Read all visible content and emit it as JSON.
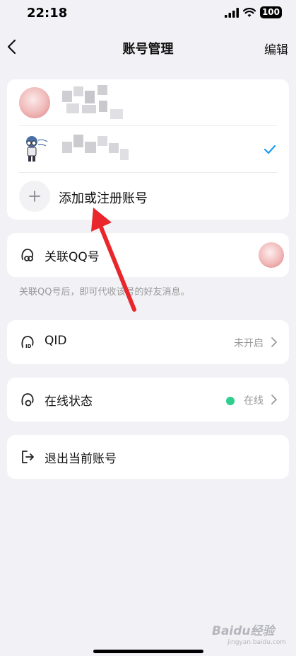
{
  "status_bar": {
    "time": "22:18",
    "battery": "100"
  },
  "nav": {
    "title": "账号管理",
    "edit_label": "编辑"
  },
  "accounts": {
    "add_label": "添加或注册账号"
  },
  "linked_qq": {
    "label": "关联QQ号",
    "hint": "关联QQ号后，即可代收该号的好友消息。"
  },
  "qid": {
    "label": "QID",
    "value": "未开启"
  },
  "online_status": {
    "label": "在线状态",
    "value": "在线",
    "dot_color": "#2ecf8c"
  },
  "logout": {
    "label": "退出当前账号"
  },
  "watermark": {
    "brand": "Baidu经验",
    "url": "jingyan.baidu.com"
  },
  "colors": {
    "accent": "#1a9bf0",
    "arrow": "#e8262b",
    "background": "#f2f2f6"
  },
  "icons": [
    "back-icon",
    "check-icon",
    "plus-icon",
    "qq-link-icon",
    "qid-icon",
    "online-status-icon",
    "logout-icon",
    "chevron-right-icon"
  ]
}
